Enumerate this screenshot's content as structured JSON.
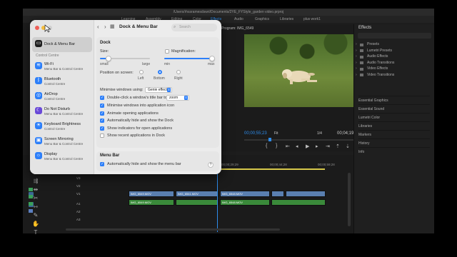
{
  "premiere": {
    "path": "/Users/rhssramesdswri/Documents/2YE_FYStyle_garden video.prproj",
    "tabs": [
      "Learning",
      "Assembly",
      "Editing",
      "Color",
      "Effects",
      "Audio",
      "Graphics",
      "Libraries",
      "plus work1"
    ],
    "active_tab": "Effects",
    "program_title": "Program: IMG_6549",
    "timecode_in": "00;00;55;23",
    "timecode_out": "00;04;19;24",
    "fit": "Fit",
    "ratio": "1/4",
    "effects_title": "Effects",
    "effects_items": [
      "Presets",
      "Lumetri Presets",
      "Audio Effects",
      "Audio Transitions",
      "Video Effects",
      "Video Transitions"
    ],
    "effects_panels": [
      "Essential Graphics",
      "Essential Sound",
      "Lumetri Color",
      "Libraries",
      "Markers",
      "History",
      "Info"
    ],
    "ruler_labels": [
      "00;00",
      "00;00;14;29",
      "00;00;29;29",
      "00;00;44;28",
      "00;00;59;28"
    ],
    "track_labels": [
      "V3",
      "V2",
      "V1",
      "A1",
      "A2",
      "A3"
    ],
    "clips": {
      "v1_a": "IMG_6549.MOV",
      "v1_b": "IMG_6541.MOV",
      "v1_c": "IMG_6548.MOV",
      "a1_a": "IMG_6549.MOV",
      "a1_b": "IMG_6548.MOV"
    },
    "transport_icons": [
      "mark-in",
      "mark-out",
      "go-to-in",
      "step-back",
      "play",
      "step-forward",
      "go-to-out",
      "lift",
      "extract",
      "export-frame"
    ]
  },
  "settings": {
    "sidebar": {
      "items_top": [
        {
          "title": "Dock & Menu Bar",
          "subtitle": "",
          "color": "#1f1f1f",
          "glyph": "▭"
        }
      ],
      "section_label": "Control Centre",
      "items": [
        {
          "title": "Wi-Fi",
          "subtitle": "Menu Bar & Control Centre",
          "color": "#2d7ff9",
          "glyph": "≋"
        },
        {
          "title": "Bluetooth",
          "subtitle": "Control Centre",
          "color": "#2d7ff9",
          "glyph": "ᛒ"
        },
        {
          "title": "AirDrop",
          "subtitle": "Control Centre",
          "color": "#2d7ff9",
          "glyph": "◎"
        },
        {
          "title": "Do Not Disturb",
          "subtitle": "Menu Bar & Control Centre",
          "color": "#6a4ad8",
          "glyph": "☾"
        },
        {
          "title": "Keyboard Brightness",
          "subtitle": "Control Centre",
          "color": "#2d7ff9",
          "glyph": "☀"
        },
        {
          "title": "Screen Mirroring",
          "subtitle": "Menu Bar & Control Centre",
          "color": "#2d7ff9",
          "glyph": "▣"
        },
        {
          "title": "Display",
          "subtitle": "Menu Bar & Control Centre",
          "color": "#2d7ff9",
          "glyph": "☼"
        }
      ]
    },
    "toolbar": {
      "title": "Dock & Menu Bar",
      "search_placeholder": "Search"
    },
    "dock": {
      "section_title": "Dock",
      "size_label": "Size:",
      "size_small": "small",
      "size_large": "large",
      "size_value": 0.17,
      "magnification_label": "Magnification:",
      "mag_min": "min",
      "mag_max": "max",
      "mag_value": 0.95,
      "position_label": "Position on screen:",
      "position_options": [
        "Left",
        "Bottom",
        "Right"
      ],
      "position_selected": "Bottom",
      "minimise_label": "Minimise windows using:",
      "minimise_value": "Genie effect",
      "doubleclick_label": "Double-click a window's title bar to",
      "doubleclick_value": "zoom",
      "checkboxes": [
        {
          "label": "Minimise windows into application icon",
          "checked": true
        },
        {
          "label": "Animate opening applications",
          "checked": true
        },
        {
          "label": "Automatically hide and show the Dock",
          "checked": true
        },
        {
          "label": "Show indicators for open applications",
          "checked": true
        },
        {
          "label": "Show recent applications in Dock",
          "checked": false
        }
      ],
      "doubleclick_checked": true,
      "magnification_checked": false
    },
    "menubar": {
      "section_title": "Menu Bar",
      "autohide_label": "Automatically hide and show the menu bar",
      "autohide_checked": true,
      "help": "?"
    }
  }
}
